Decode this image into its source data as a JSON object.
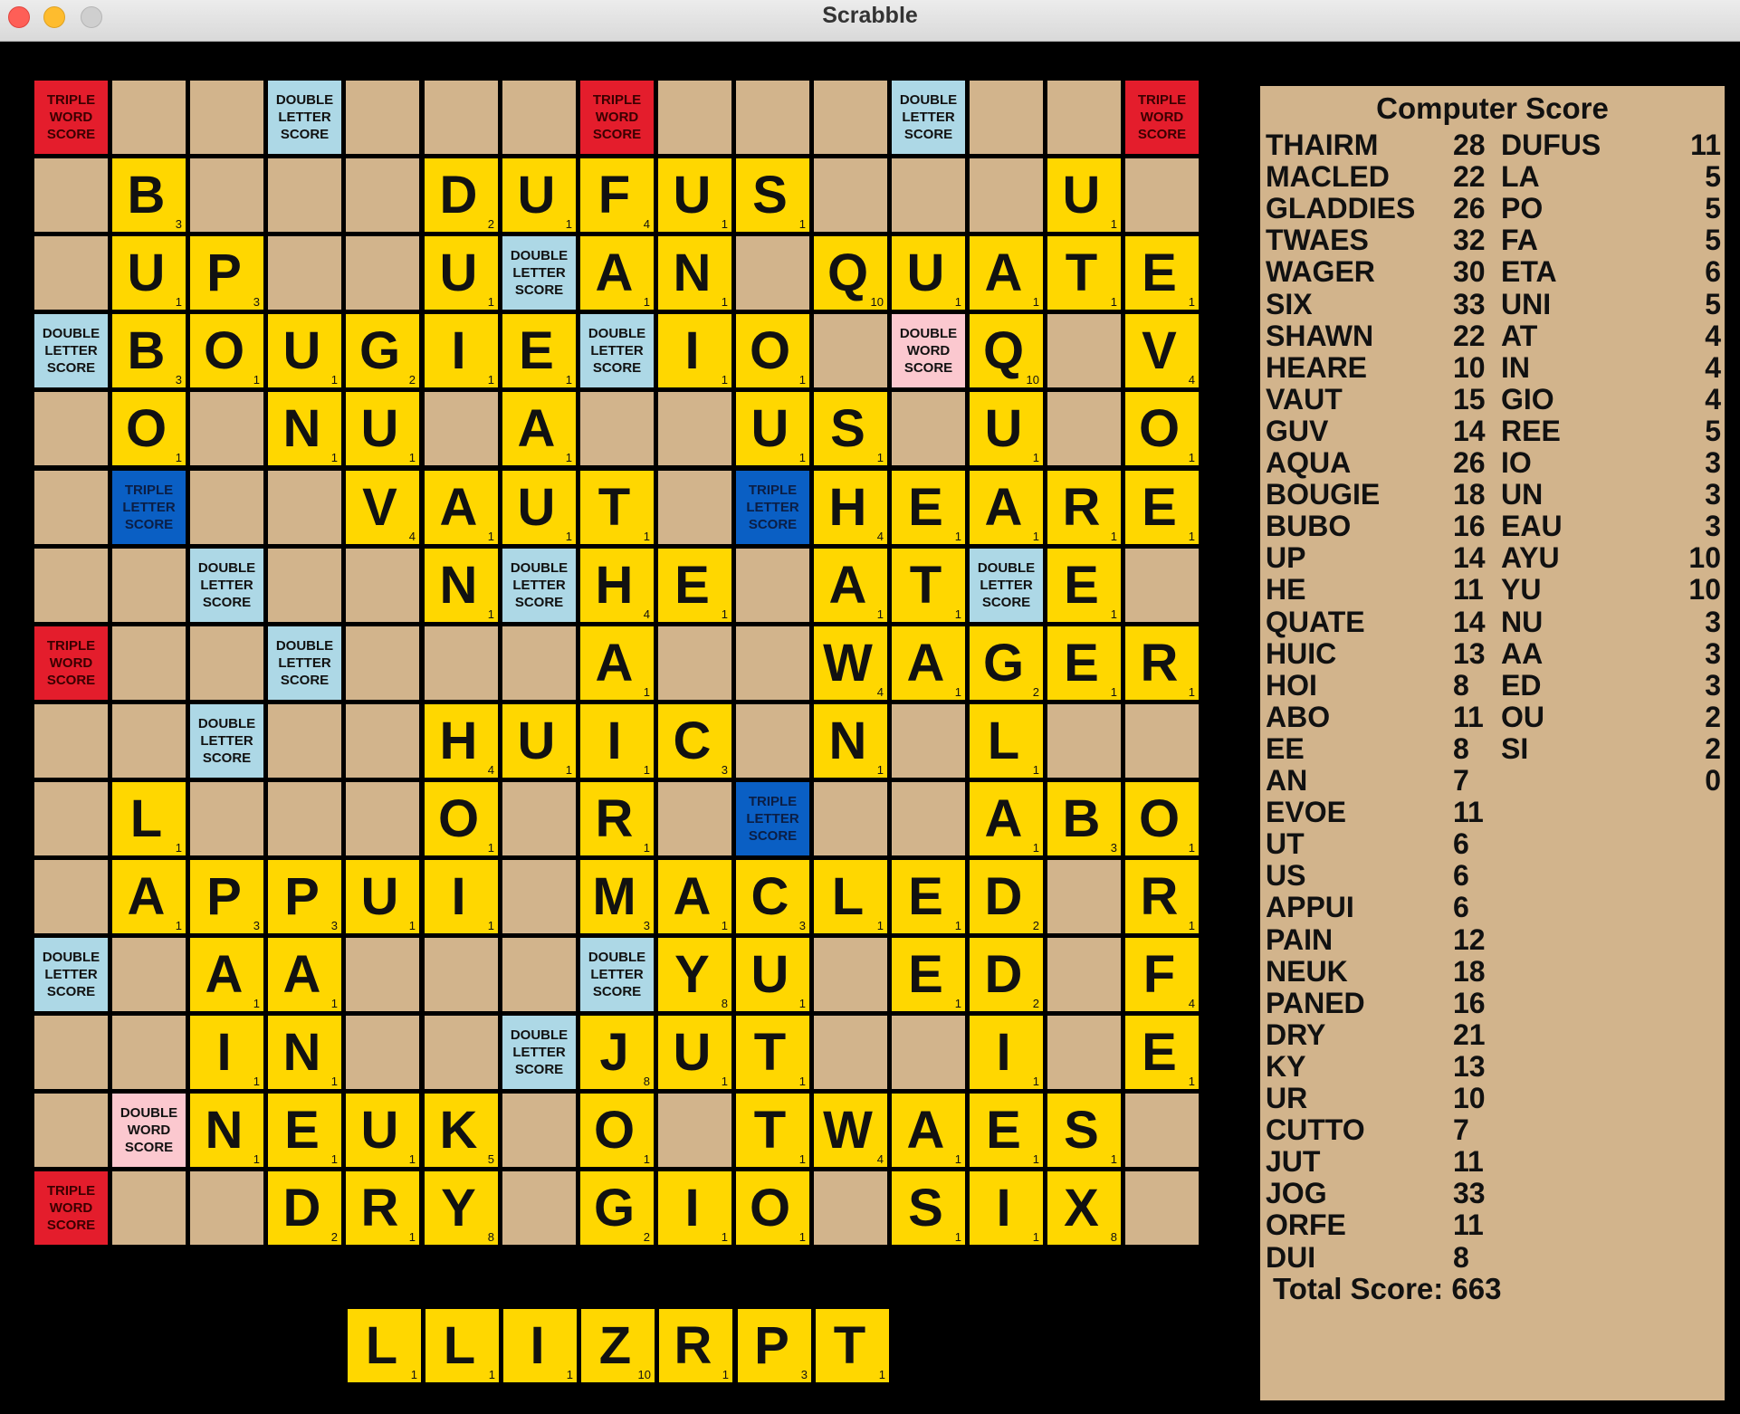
{
  "window": {
    "title": "Scrabble"
  },
  "board": {
    "rows": [
      "...............",
      ".B.....DUFUS..U.",
      ".UP...U.AN.QUATE",
      ".BOUGIE.IO..Q.V",
      ".O.NU.A..US..U.O",
      "....VAUT...HEARE",
      ".....N..HE.AT.E.",
      "........A..WAGER",
      ".....HUIC..N.L..",
      ".L...O..R....ABO",
      ".APPUI..MACLED.R",
      "..AA.....YU.ED.F",
      "..IN....JUT...I.E",
      "..NEUK..O.TWAES.",
      "...DRY..GIO.SIX"
    ],
    "tiles": [
      [
        "",
        "",
        "",
        "",
        "",
        "",
        "",
        "",
        "",
        "",
        "",
        "",
        "",
        "",
        ""
      ],
      [
        "",
        "B",
        "",
        "",
        "",
        "D",
        "U",
        "F",
        "U",
        "S",
        "",
        "",
        "",
        "U",
        ""
      ],
      [
        "",
        "U",
        "P",
        "",
        "",
        "U",
        "",
        "A",
        "N",
        "",
        "Q",
        "U",
        "A",
        "T",
        "E"
      ],
      [
        "",
        "B",
        "O",
        "U",
        "G",
        "I",
        "E",
        "",
        "I",
        "O",
        "",
        "",
        "Q",
        "",
        "V"
      ],
      [
        "",
        "O",
        "",
        "N",
        "U",
        "",
        "A",
        "",
        "",
        "U",
        "S",
        "",
        "U",
        "",
        "O"
      ],
      [
        "",
        "",
        "",
        "",
        "V",
        "A",
        "U",
        "T",
        "",
        "",
        "H",
        "E",
        "A",
        "R",
        "E"
      ],
      [
        "",
        "",
        "",
        "",
        "",
        "N",
        "",
        "H",
        "E",
        "",
        "A",
        "T",
        "",
        "E",
        ""
      ],
      [
        "",
        "",
        "",
        "",
        "",
        "",
        "",
        "A",
        "",
        "",
        "W",
        "A",
        "G",
        "E",
        "R"
      ],
      [
        "",
        "",
        "",
        "",
        "",
        "H",
        "U",
        "I",
        "C",
        "",
        "N",
        "",
        "L",
        "",
        ""
      ],
      [
        "",
        "L",
        "",
        "",
        "",
        "O",
        "",
        "R",
        "",
        "",
        "",
        "",
        "A",
        "B",
        "O"
      ],
      [
        "",
        "A",
        "P",
        "P",
        "U",
        "I",
        "",
        "M",
        "A",
        "C",
        "L",
        "E",
        "D",
        "",
        "R"
      ],
      [
        "",
        "",
        "A",
        "A",
        "",
        "",
        "",
        "",
        "Y",
        "U",
        "",
        "E",
        "D",
        "",
        "F"
      ],
      [
        "",
        "",
        "I",
        "N",
        "",
        "",
        "",
        "J",
        "U",
        "T",
        "",
        "",
        "I",
        "",
        "E"
      ],
      [
        "",
        "",
        "N",
        "E",
        "U",
        "K",
        "",
        "O",
        "",
        "T",
        "W",
        "A",
        "E",
        "S",
        ""
      ],
      [
        "",
        "",
        "",
        "D",
        "R",
        "Y",
        "",
        "G",
        "I",
        "O",
        "",
        "S",
        "I",
        "X",
        ""
      ]
    ],
    "premiums": [
      {
        "row": 0,
        "col": 0,
        "type": "TW",
        "label": "TRIPLE WORD SCORE"
      },
      {
        "row": 0,
        "col": 3,
        "type": "DL",
        "label": "DOUBLE LETTER SCORE"
      },
      {
        "row": 0,
        "col": 7,
        "type": "TW",
        "label": "TRIPLE WORD SCORE"
      },
      {
        "row": 0,
        "col": 11,
        "type": "DL",
        "label": "DOUBLE LETTER SCORE"
      },
      {
        "row": 0,
        "col": 14,
        "type": "TW",
        "label": "TRIPLE WORD SCORE"
      },
      {
        "row": 2,
        "col": 6,
        "type": "DL",
        "label": "DOUBLE LETTER SCORE"
      },
      {
        "row": 3,
        "col": 0,
        "type": "DL",
        "label": "DOUBLE LETTER SCORE"
      },
      {
        "row": 3,
        "col": 7,
        "type": "DL",
        "label": "DOUBLE LETTER SCORE"
      },
      {
        "row": 3,
        "col": 11,
        "type": "DW",
        "label": "DOUBLE WORD SCORE"
      },
      {
        "row": 5,
        "col": 1,
        "type": "TL",
        "label": "TRIPLE LETTER SCORE"
      },
      {
        "row": 5,
        "col": 9,
        "type": "TL",
        "label": "TRIPLE LETTER SCORE"
      },
      {
        "row": 6,
        "col": 2,
        "type": "DL",
        "label": "DOUBLE LETTER SCORE"
      },
      {
        "row": 6,
        "col": 6,
        "type": "DL",
        "label": "DOUBLE LETTER SCORE"
      },
      {
        "row": 6,
        "col": 12,
        "type": "DL",
        "label": "DOUBLE LETTER SCORE"
      },
      {
        "row": 7,
        "col": 0,
        "type": "TW",
        "label": "TRIPLE WORD SCORE"
      },
      {
        "row": 7,
        "col": 3,
        "type": "DL",
        "label": "DOUBLE LETTER SCORE"
      },
      {
        "row": 8,
        "col": 2,
        "type": "DL",
        "label": "DOUBLE LETTER SCORE"
      },
      {
        "row": 9,
        "col": 9,
        "type": "TL",
        "label": "TRIPLE LETTER SCORE"
      },
      {
        "row": 11,
        "col": 0,
        "type": "DL",
        "label": "DOUBLE LETTER SCORE"
      },
      {
        "row": 11,
        "col": 7,
        "type": "DL",
        "label": "DOUBLE LETTER SCORE"
      },
      {
        "row": 12,
        "col": 6,
        "type": "DL",
        "label": "DOUBLE LETTER SCORE"
      },
      {
        "row": 13,
        "col": 1,
        "type": "DW",
        "label": "DOUBLE WORD SCORE"
      },
      {
        "row": 14,
        "col": 0,
        "type": "TW",
        "label": "TRIPLE WORD SCORE"
      },
      {
        "row": 14,
        "col": 11,
        "type": "DL",
        "label": "DOUBLE LETTER SCORE"
      }
    ]
  },
  "letter_points": {
    "A": 1,
    "B": 3,
    "C": 3,
    "D": 2,
    "E": 1,
    "F": 4,
    "G": 2,
    "H": 4,
    "I": 1,
    "J": 8,
    "K": 5,
    "L": 1,
    "M": 3,
    "N": 1,
    "O": 1,
    "P": 3,
    "Q": 10,
    "R": 1,
    "S": 1,
    "T": 1,
    "U": 1,
    "V": 4,
    "W": 4,
    "X": 8,
    "Y": 8,
    "Z": 10
  },
  "rack": {
    "tiles": [
      {
        "letter": "L",
        "points": 1
      },
      {
        "letter": "L",
        "points": 1
      },
      {
        "letter": "I",
        "points": 1
      },
      {
        "letter": "Z",
        "points": 10
      },
      {
        "letter": "R",
        "points": 1
      },
      {
        "letter": "P",
        "points": 3
      },
      {
        "letter": "T",
        "points": 1
      }
    ]
  },
  "score_panel": {
    "title": "Computer Score",
    "col1": [
      {
        "word": "THAIRM",
        "score": "28"
      },
      {
        "word": "MACLED",
        "score": "22"
      },
      {
        "word": "GLADDIES",
        "score": "26"
      },
      {
        "word": "TWAES",
        "score": "32"
      },
      {
        "word": "WAGER",
        "score": "30"
      },
      {
        "word": "SIX",
        "score": "33"
      },
      {
        "word": "SHAWN",
        "score": "22"
      },
      {
        "word": "HEARE",
        "score": "10"
      },
      {
        "word": "VAUT",
        "score": "15"
      },
      {
        "word": "GUV",
        "score": "14"
      },
      {
        "word": "AQUA",
        "score": "26"
      },
      {
        "word": "BOUGIE",
        "score": "18"
      },
      {
        "word": "BUBO",
        "score": "16"
      },
      {
        "word": "UP",
        "score": "14"
      },
      {
        "word": "HE",
        "score": "11"
      },
      {
        "word": "QUATE",
        "score": "14"
      },
      {
        "word": "HUIC",
        "score": "13"
      },
      {
        "word": "HOI",
        "score": "8"
      },
      {
        "word": "ABO",
        "score": "11"
      },
      {
        "word": "EE",
        "score": "8"
      },
      {
        "word": "AN",
        "score": "7"
      },
      {
        "word": "EVOE",
        "score": "11"
      },
      {
        "word": "UT",
        "score": "6"
      },
      {
        "word": "US",
        "score": "6"
      },
      {
        "word": "APPUI",
        "score": "6"
      },
      {
        "word": "PAIN",
        "score": "12"
      },
      {
        "word": "NEUK",
        "score": "18"
      },
      {
        "word": "PANED",
        "score": "16"
      },
      {
        "word": "DRY",
        "score": "21"
      },
      {
        "word": "KY",
        "score": "13"
      },
      {
        "word": "UR",
        "score": "10"
      },
      {
        "word": "CUTTO",
        "score": "7"
      },
      {
        "word": "JUT",
        "score": "11"
      },
      {
        "word": "JOG",
        "score": "33"
      },
      {
        "word": "ORFE",
        "score": "11"
      },
      {
        "word": "DUI",
        "score": "8"
      }
    ],
    "col2": [
      {
        "word": "DUFUS",
        "score": "11"
      },
      {
        "word": "LA",
        "score": "5"
      },
      {
        "word": "PO",
        "score": "5"
      },
      {
        "word": "FA",
        "score": "5"
      },
      {
        "word": "ETA",
        "score": "6"
      },
      {
        "word": "UNI",
        "score": "5"
      },
      {
        "word": "AT",
        "score": "4"
      },
      {
        "word": "IN",
        "score": "4"
      },
      {
        "word": "GIO",
        "score": "4"
      },
      {
        "word": "REE",
        "score": "5"
      },
      {
        "word": "IO",
        "score": "3"
      },
      {
        "word": "UN",
        "score": "3"
      },
      {
        "word": "EAU",
        "score": "3"
      },
      {
        "word": "AYU",
        "score": "10"
      },
      {
        "word": "YU",
        "score": "10"
      },
      {
        "word": "NU",
        "score": "3"
      },
      {
        "word": "AA",
        "score": "3"
      },
      {
        "word": "ED",
        "score": "3"
      },
      {
        "word": "OU",
        "score": "2"
      },
      {
        "word": "SI",
        "score": "2"
      },
      {
        "word": "",
        "score": "0"
      }
    ],
    "total_label": "Total Score: 663"
  },
  "colors": {
    "background": "#000000",
    "tile": "#ffd700",
    "empty_square": "#d2b48c",
    "triple_word": "#e41d2c",
    "double_word": "#fbc8cf",
    "double_letter": "#add8e6",
    "triple_letter": "#0a5fc4"
  }
}
